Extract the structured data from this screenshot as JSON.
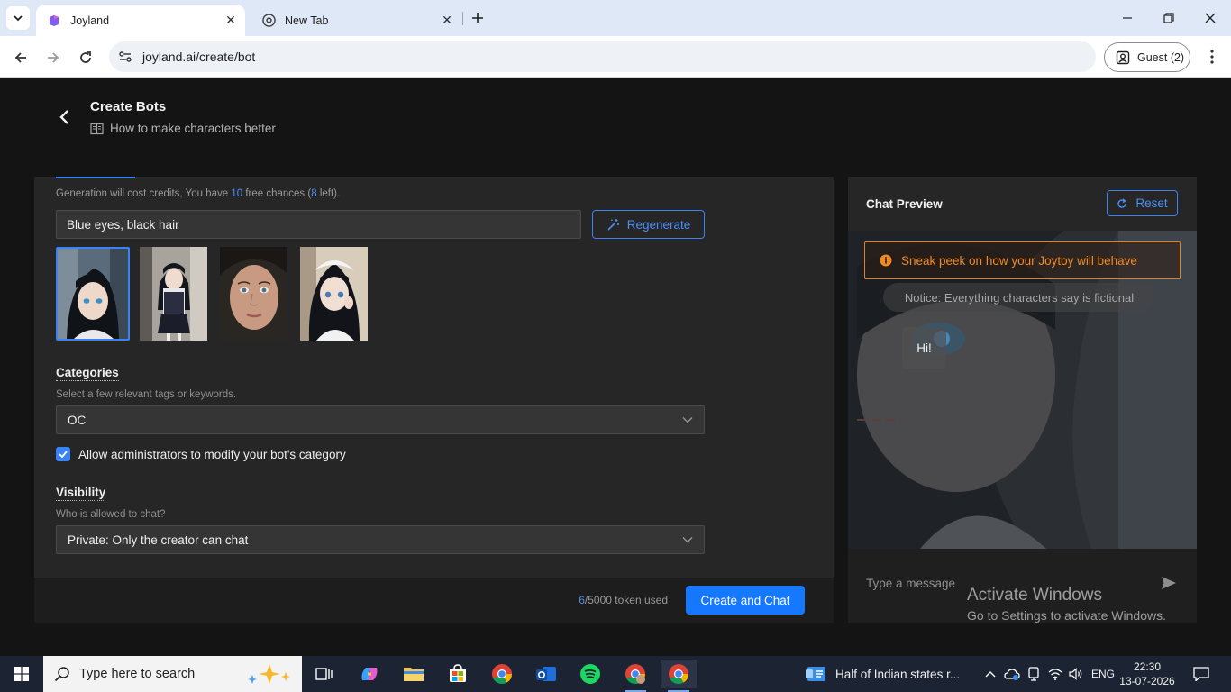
{
  "browser": {
    "tabs": [
      {
        "title": "Joyland",
        "active": true
      },
      {
        "title": "New Tab",
        "active": false
      }
    ],
    "url": "joyland.ai/create/bot",
    "profile_label": "Guest (2)"
  },
  "header": {
    "title": "Create Bots",
    "help_link": "How to make characters better"
  },
  "form": {
    "credits_note": {
      "prefix": "Generation will cost credits, You have ",
      "free_count": "10",
      "middle": " free chances (",
      "left_count": "8",
      "suffix": " left)."
    },
    "prompt_value": "Blue eyes, black hair",
    "regenerate_label": "Regenerate",
    "selected_image_index": 0,
    "categories": {
      "label": "Categories",
      "help": "Select a few relevant tags or keywords.",
      "value": "OC"
    },
    "allow_admin": {
      "label": "Allow administrators to modify your bot's category",
      "checked": true
    },
    "visibility": {
      "label": "Visibility",
      "help": "Who is allowed to chat?",
      "value": "Private: Only the creator can chat"
    },
    "tokens": {
      "used": "6",
      "rest": "/5000 token used"
    },
    "create_label": "Create and Chat"
  },
  "chat": {
    "title": "Chat Preview",
    "reset_label": "Reset",
    "warning": "Sneak peek on how your Joytoy will behave",
    "notice": "Notice: Everything characters say is fictional",
    "first_message": "Hi!",
    "input_placeholder": "Type a message"
  },
  "watermark": {
    "line1": "Activate Windows",
    "line2": "Go to Settings to activate Windows."
  },
  "taskbar": {
    "search_placeholder": "Type here to search",
    "news": "Half of Indian states r...",
    "language": "ENG",
    "time": "22:30",
    "date": "13-07-2026"
  },
  "colors": {
    "accent": "#1677ff",
    "warning": "#f08a24",
    "panel": "#262626",
    "page": "#141414"
  }
}
